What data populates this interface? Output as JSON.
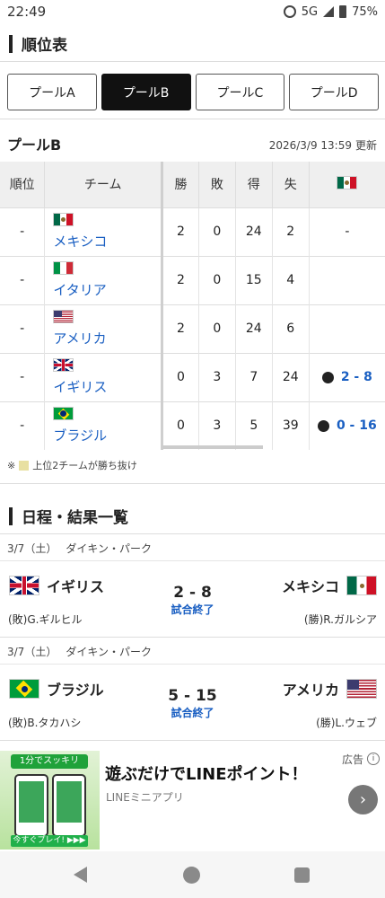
{
  "status_bar": {
    "time": "22:49",
    "network": "5G",
    "battery": "75%"
  },
  "standings_heading": "順位表",
  "tabs": [
    {
      "label": "プールA",
      "active": false
    },
    {
      "label": "プールB",
      "active": true
    },
    {
      "label": "プールC",
      "active": false
    },
    {
      "label": "プールD",
      "active": false
    }
  ],
  "pool_title": "プールB",
  "updated": {
    "datetime": "2026/3/9 13:59",
    "label": "更新"
  },
  "table": {
    "headers": {
      "rank": "順位",
      "team": "チーム",
      "wins": "勝",
      "losses": "敗",
      "runs_for": "得",
      "runs_against": "失",
      "h2h_flag": "mexico-flag"
    },
    "rows": [
      {
        "rank": "-",
        "team": "メキシコ",
        "flag": "mexico-flag",
        "wins": "2",
        "losses": "0",
        "runs_for": "24",
        "runs_against": "2",
        "h2h": "-",
        "h2h_result": ""
      },
      {
        "rank": "-",
        "team": "イタリア",
        "flag": "italy-flag",
        "wins": "2",
        "losses": "0",
        "runs_for": "15",
        "runs_against": "4",
        "h2h": "",
        "h2h_result": ""
      },
      {
        "rank": "-",
        "team": "アメリカ",
        "flag": "usa-flag",
        "wins": "2",
        "losses": "0",
        "runs_for": "24",
        "runs_against": "6",
        "h2h": "",
        "h2h_result": ""
      },
      {
        "rank": "-",
        "team": "イギリス",
        "flag": "uk-flag",
        "wins": "0",
        "losses": "3",
        "runs_for": "7",
        "runs_against": "24",
        "h2h": "2 - 8",
        "h2h_result": "loss"
      },
      {
        "rank": "-",
        "team": "ブラジル",
        "flag": "brazil-flag",
        "wins": "0",
        "losses": "3",
        "runs_for": "5",
        "runs_against": "39",
        "h2h": "0 - 16",
        "h2h_result": "loss"
      }
    ]
  },
  "note": {
    "mark": "※",
    "text": "上位2チームが勝ち抜け"
  },
  "schedule_heading": "日程・結果一覧",
  "matches": [
    {
      "date": "3/7（土）",
      "venue": "ダイキン・パーク",
      "home": "イギリス",
      "away": "メキシコ",
      "score": "2 - 8",
      "status": "試合終了",
      "home_pitcher": "(敗)G.ギルヒル",
      "away_pitcher": "(勝)R.ガルシア"
    },
    {
      "date": "3/7（土）",
      "venue": "ダイキン・パーク",
      "home": "ブラジル",
      "away": "アメリカ",
      "score": "5 - 15",
      "status": "試合終了",
      "home_pitcher": "(敗)B.タカハシ",
      "away_pitcher": "(勝)L.ウェブ"
    }
  ],
  "ad": {
    "label": "広告",
    "title": "遊ぶだけでLINEポイント！",
    "subtitle": "LINEミニアプリ",
    "image_band": "1分でスッキリ",
    "image_cta": "今すぐプレイ! ▶▶▶",
    "arrow": "›"
  }
}
